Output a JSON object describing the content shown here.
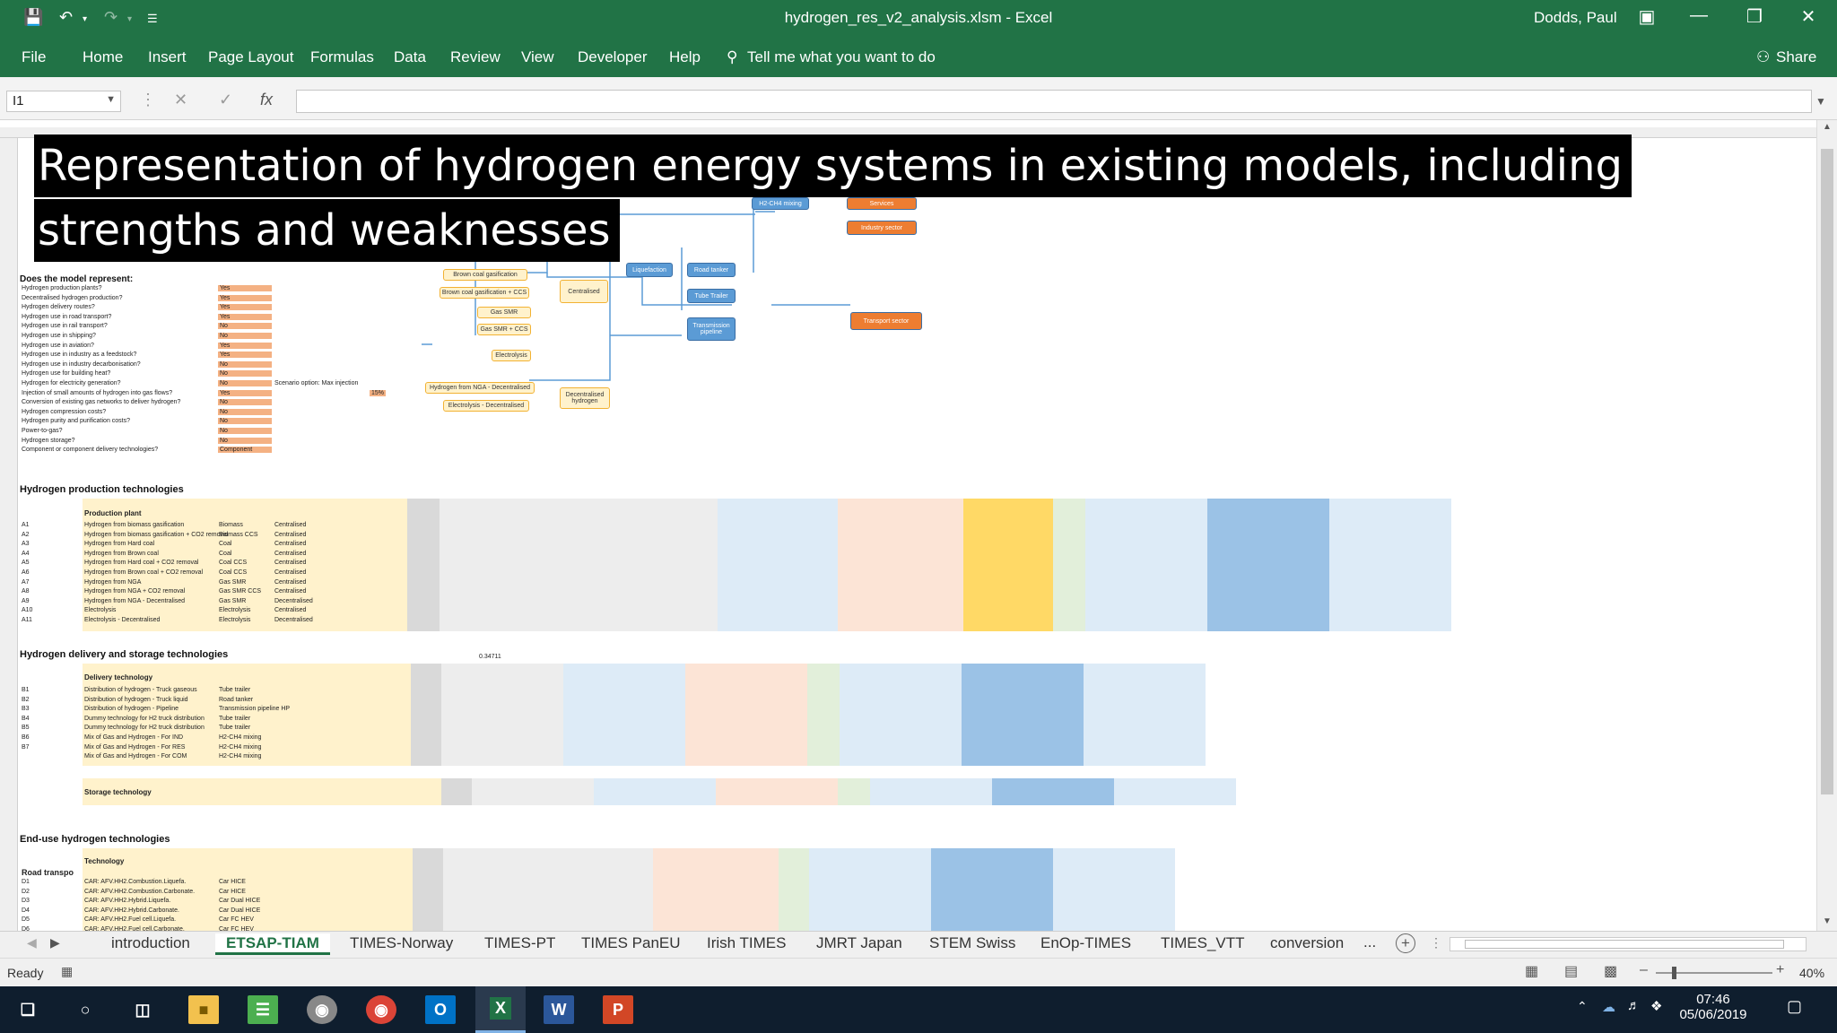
{
  "window": {
    "title": "hydrogen_res_v2_analysis.xlsm  -  Excel",
    "user": "Dodds, Paul"
  },
  "menu": {
    "items": [
      "File",
      "Home",
      "Insert",
      "Page Layout",
      "Formulas",
      "Data",
      "Review",
      "View",
      "Developer",
      "Help"
    ],
    "tell_me": "Tell me what you want to do",
    "share": "Share"
  },
  "formula_bar": {
    "name_box": "I1",
    "fx": "fx",
    "value": ""
  },
  "overlay": {
    "line1": "Representation of hydrogen energy systems in existing models, including",
    "line2": "strengths and weaknesses"
  },
  "sheet": {
    "sections": {
      "does_model_represent": "Does the model represent:",
      "production": "Hydrogen production technologies",
      "delivery": "Hydrogen delivery and storage technologies",
      "enduse": "End-use hydrogen technologies"
    },
    "questions": [
      {
        "q": "Hydrogen production plants?",
        "a": "Yes"
      },
      {
        "q": "Decentralised hydrogen production?",
        "a": "Yes"
      },
      {
        "q": "Hydrogen delivery routes?",
        "a": "Yes"
      },
      {
        "q": "Hydrogen use in road transport?",
        "a": "Yes"
      },
      {
        "q": "Hydrogen use in rail transport?",
        "a": "No"
      },
      {
        "q": "Hydrogen use in shipping?",
        "a": "No"
      },
      {
        "q": "Hydrogen use in aviation?",
        "a": "Yes"
      },
      {
        "q": "Hydrogen use in industry as a feedstock?",
        "a": "Yes"
      },
      {
        "q": "Hydrogen use in industry decarbonisation?",
        "a": "No"
      },
      {
        "q": "Hydrogen use for building heat?",
        "a": "No"
      },
      {
        "q": "Hydrogen for electricity generation?",
        "a": "No"
      },
      {
        "q": "Injection of small amounts of hydrogen into gas flows?",
        "a": "Yes"
      },
      {
        "q": "Conversion of existing gas networks to deliver hydrogen?",
        "a": "No"
      },
      {
        "q": "Hydrogen compression costs?",
        "a": "No"
      },
      {
        "q": "Hydrogen purity and purification costs?",
        "a": "No"
      },
      {
        "q": "Power-to-gas?",
        "a": "No"
      },
      {
        "q": "Hydrogen storage?",
        "a": "No"
      },
      {
        "q": "Component or component delivery technologies?",
        "a": "Component"
      }
    ],
    "scenario_note": "Scenario option: Max injection",
    "scenario_value": "15%",
    "diagram": {
      "nodes": [
        "H2-CH4 mixing",
        "Services",
        "Industry sector",
        "Brown coal gasification",
        "Brown coal gasification + CCS",
        "Gas SMR",
        "Gas SMR + CCS",
        "Electrolysis",
        "Centralised",
        "Liquefaction",
        "Road tanker",
        "Tube Trailer",
        "Transmission pipeline",
        "Transport sector",
        "Hydrogen from NGA - Decentralised",
        "Electrolysis - Decentralised",
        "Decentralised hydrogen"
      ]
    },
    "production_header": "Production plant",
    "production_rows": [
      {
        "id": "A1",
        "desc": "Hydrogen from biomass gasification",
        "type": "Biomass",
        "loc": "Centralised"
      },
      {
        "id": "A2",
        "desc": "Hydrogen from biomass gasification + CO2 removal",
        "type": "Biomass CCS",
        "loc": "Centralised"
      },
      {
        "id": "A3",
        "desc": "Hydrogen from Hard coal",
        "type": "Coal",
        "loc": "Centralised"
      },
      {
        "id": "A4",
        "desc": "Hydrogen from Brown coal",
        "type": "Coal",
        "loc": "Centralised"
      },
      {
        "id": "A5",
        "desc": "Hydrogen from Hard coal + CO2 removal",
        "type": "Coal CCS",
        "loc": "Centralised"
      },
      {
        "id": "A6",
        "desc": "Hydrogen from Brown coal + CO2 removal",
        "type": "Coal CCS",
        "loc": "Centralised"
      },
      {
        "id": "A7",
        "desc": "Hydrogen from NGA",
        "type": "Gas SMR",
        "loc": "Centralised"
      },
      {
        "id": "A8",
        "desc": "Hydrogen from NGA + CO2 removal",
        "type": "Gas SMR CCS",
        "loc": "Centralised"
      },
      {
        "id": "A9",
        "desc": "Hydrogen from NGA - Decentralised",
        "type": "Gas SMR",
        "loc": "Decentralised"
      },
      {
        "id": "A10",
        "desc": "Electrolysis",
        "type": "Electrolysis",
        "loc": "Centralised"
      },
      {
        "id": "A11",
        "desc": "Electrolysis - Decentralised",
        "type": "Electrolysis",
        "loc": "Decentralised"
      }
    ],
    "delivery_header": "Delivery technology",
    "delivery_rows": [
      {
        "id": "B1",
        "desc": "Distribution of hydrogen - Truck gaseous",
        "type": "Tube trailer"
      },
      {
        "id": "B2",
        "desc": "Distribution of hydrogen - Truck liquid",
        "type": "Road tanker"
      },
      {
        "id": "B3",
        "desc": "Distribution of hydrogen - Pipeline",
        "type": "Transmission pipeline HP"
      },
      {
        "id": "B4",
        "desc": "Dummy technology for H2 truck distribution",
        "type": "Tube trailer"
      },
      {
        "id": "B5",
        "desc": "Dummy technology for H2 truck distribution",
        "type": "Tube trailer"
      },
      {
        "id": "B6",
        "desc": "Mix of Gas and Hydrogen - For IND",
        "type": "H2-CH4 mixing"
      },
      {
        "id": "B7",
        "desc": "Mix of Gas and Hydrogen - For RES",
        "type": "H2-CH4 mixing"
      },
      {
        "id": "",
        "desc": "Mix of Gas and Hydrogen - For COM",
        "type": "H2-CH4 mixing"
      }
    ],
    "storage_header": "Storage technology",
    "enduse_header": "Technology",
    "enduse_label": "Road transpo",
    "enduse_rows": [
      {
        "id": "D1",
        "desc": "CAR: AFV.HH2.Combustion.Liquefa.",
        "type": "Car HICE"
      },
      {
        "id": "D2",
        "desc": "CAR: AFV.HH2.Combustion.Carbonate.",
        "type": "Car HICE"
      },
      {
        "id": "D3",
        "desc": "CAR: AFV.HH2.Hybrid.Liquefa.",
        "type": "Car Dual HICE"
      },
      {
        "id": "D4",
        "desc": "CAR: AFV.HH2.Hybrid.Carbonate.",
        "type": "Car Dual HICE"
      },
      {
        "id": "D5",
        "desc": "CAR: AFV.HH2.Fuel cell.Liquefa.",
        "type": "Car FC HEV"
      },
      {
        "id": "D6",
        "desc": "CAR: AFV.HH2.Fuel cell.Carbonate.",
        "type": "Car FC HEV"
      }
    ],
    "floating_value": "0.34711"
  },
  "sheet_tabs": {
    "tabs": [
      "introduction",
      "ETSAP-TIAM",
      "TIMES-Norway",
      "TIMES-PT",
      "TIMES PanEU",
      "Irish TIMES",
      "JMRT Japan",
      "STEM Swiss",
      "EnOp-TIMES",
      "TIMES_VTT",
      "conversion"
    ],
    "active": "ETSAP-TIAM",
    "more": "..."
  },
  "status": {
    "ready": "Ready",
    "zoom": "40%"
  },
  "taskbar": {
    "time": "07:46",
    "date": "05/06/2019"
  },
  "colors": {
    "excel_green": "#217346",
    "input_orange": "#f4b183",
    "light_yellow": "#fff2cc",
    "light_blue": "#ddebf7",
    "mid_blue": "#9bc2e6",
    "light_salmon": "#fce4d6",
    "gray": "#d9d9d9",
    "node_blue": "#5b9bd5",
    "node_orange": "#ed7d31",
    "node_yellow": "#fff2cc"
  }
}
